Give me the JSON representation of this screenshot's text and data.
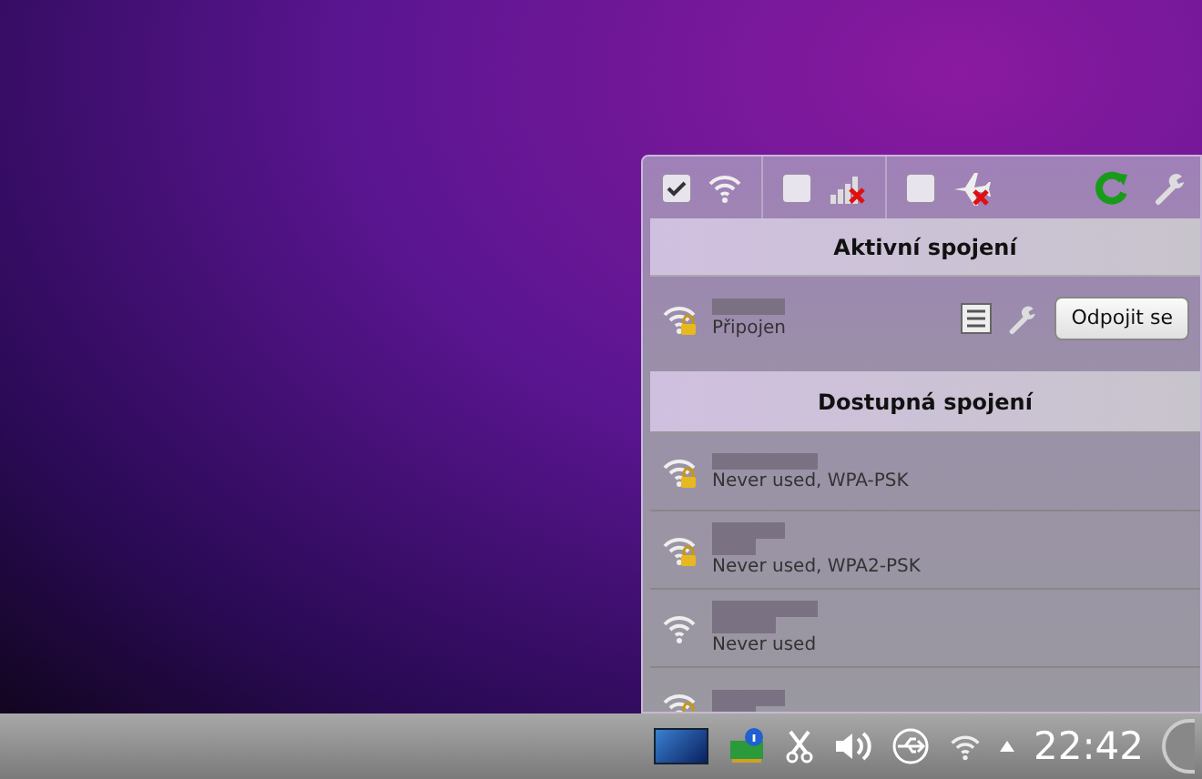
{
  "toolbar": {
    "toggles": [
      {
        "kind": "wireless",
        "checked": true
      },
      {
        "kind": "mobile",
        "checked": false
      },
      {
        "kind": "airplane",
        "checked": false
      }
    ]
  },
  "active_section": {
    "title": "Aktivní spojení",
    "connections": [
      {
        "status": "Připojen",
        "secured": true
      }
    ],
    "disconnect_button": "Odpojit se"
  },
  "available_section": {
    "title": "Dostupná spojení",
    "connections": [
      {
        "status": "Never used, WPA-PSK",
        "secured": true
      },
      {
        "status": "Never used, WPA2-PSK",
        "secured": true
      },
      {
        "status": "Never used",
        "secured": false
      },
      {
        "secured": true
      }
    ]
  },
  "taskbar": {
    "clock": "22:42"
  }
}
